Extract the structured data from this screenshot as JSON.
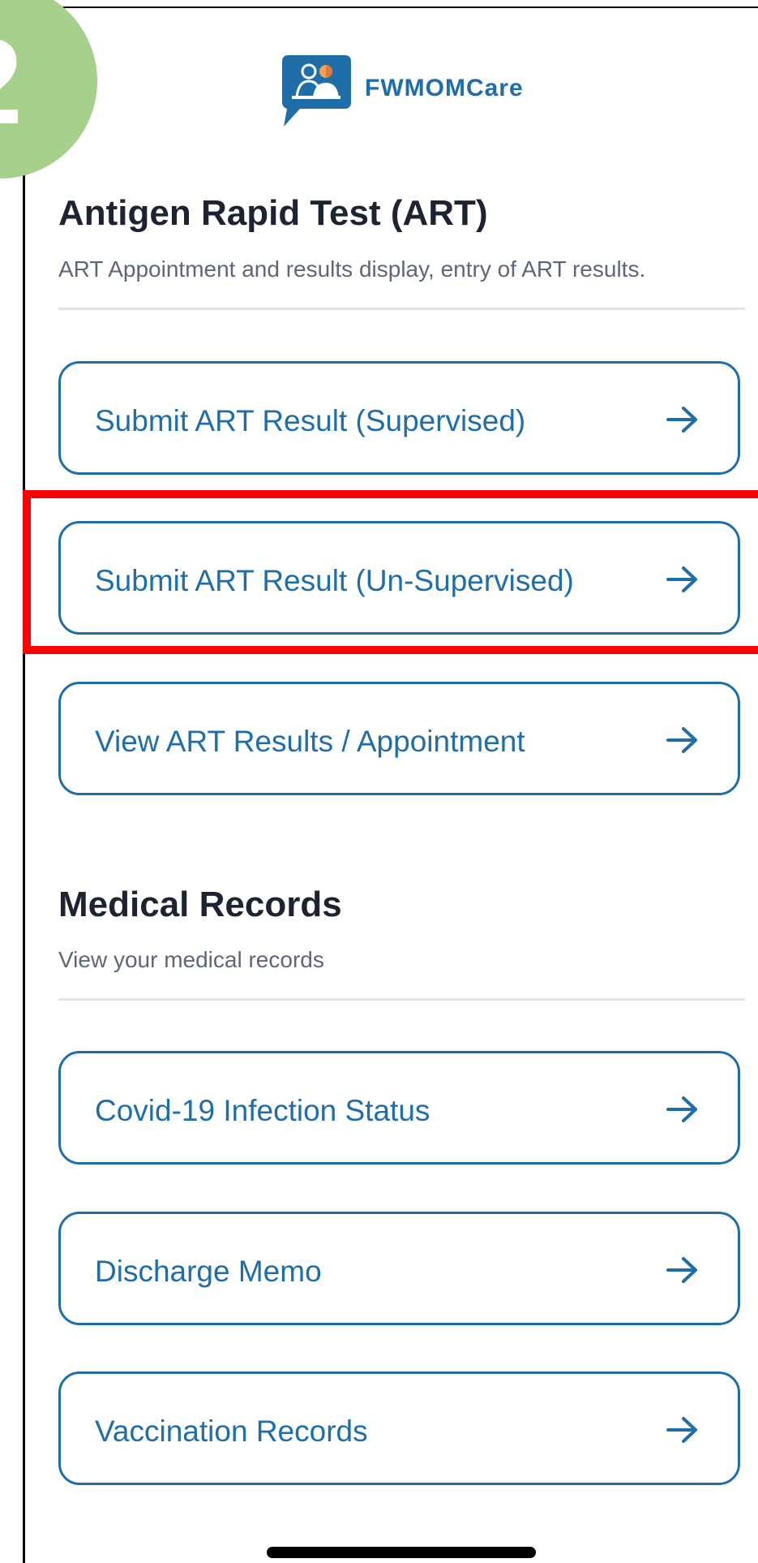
{
  "step_badge": {
    "text": "2"
  },
  "app": {
    "name": "FWMOMCare",
    "logo_icon": "doctor-patient-chat-icon"
  },
  "sections": {
    "art": {
      "title": "Antigen Rapid Test (ART)",
      "description": "ART Appointment and results display, entry of ART results."
    },
    "medical": {
      "title": "Medical Records",
      "description": "View your medical records"
    }
  },
  "cards": {
    "supervised": "Submit ART Result (Supervised)",
    "unsupervised": "Submit ART Result (Un-Supervised)",
    "view_results": "View ART Results / Appointment",
    "covid_status": "Covid-19 Infection Status",
    "discharge_memo": "Discharge Memo",
    "vaccination_records": "Vaccination Records"
  },
  "icons": {
    "card_arrow": "arrow-right-icon"
  },
  "colors": {
    "accent": "#1f6ea8",
    "title": "#1e2331",
    "description": "#5d6778",
    "highlight": "#ff0000",
    "badge": "#a8d08d"
  }
}
